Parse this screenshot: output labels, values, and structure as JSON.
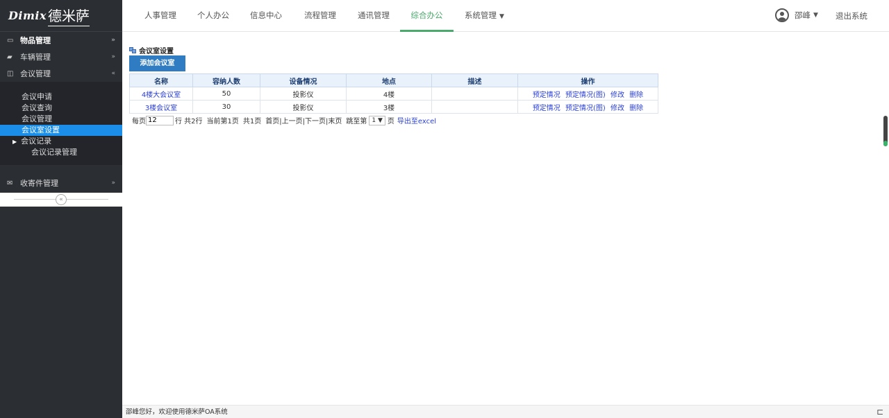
{
  "logo": {
    "latin": "Dimix",
    "cn": "德米萨"
  },
  "topnav": {
    "items": [
      {
        "label": "人事管理",
        "active": false
      },
      {
        "label": "个人办公",
        "active": false
      },
      {
        "label": "信息中心",
        "active": false
      },
      {
        "label": "流程管理",
        "active": false
      },
      {
        "label": "通讯管理",
        "active": false
      },
      {
        "label": "综合办公",
        "active": true
      },
      {
        "label": "系统管理",
        "active": false
      }
    ],
    "user_name": "邵峰",
    "logout": "退出系统"
  },
  "sidebar": {
    "groups": [
      {
        "label": "物品管理",
        "icon": "tray-icon",
        "chevron": "»"
      },
      {
        "label": "车辆管理",
        "icon": "truck-icon",
        "chevron": "»"
      },
      {
        "label": "会议管理",
        "icon": "columns-icon",
        "chevron": "«"
      }
    ],
    "sub_items": [
      {
        "label": "会议申请"
      },
      {
        "label": "会议查询"
      },
      {
        "label": "会议管理"
      },
      {
        "label": "会议室设置"
      },
      {
        "label": "会议记录"
      },
      {
        "label": "会议记录管理"
      }
    ],
    "mail_group": {
      "label": "收寄件管理",
      "icon": "envelope-icon",
      "chevron": "»"
    },
    "collapse_symbol": "«"
  },
  "main": {
    "title": "会议室设置",
    "add_button": "添加会议室",
    "columns": [
      "名称",
      "容纳人数",
      "设备情况",
      "地点",
      "描述",
      "操作"
    ],
    "rows": [
      {
        "name": "4楼大会议室",
        "capacity": "50",
        "equipment": "投影仪",
        "location": "4楼",
        "desc": ""
      },
      {
        "name": "3楼会议室",
        "capacity": "30",
        "equipment": "投影仪",
        "location": "3楼",
        "desc": ""
      }
    ],
    "row_actions": [
      "预定情况",
      "预定情况(图)",
      "修改",
      "删除"
    ],
    "pager": {
      "per_page_label": "每页",
      "per_page_value": "12",
      "rows_info": "行 共2行",
      "current": "当前第1页",
      "total_pages": "共1页",
      "nav": "首页|上一页|下一页|末页",
      "jump_label": "跳至第",
      "jump_value": "1 ▼",
      "page_suffix": "页",
      "export": "导出至excel"
    }
  },
  "footer": {
    "greeting": "邵峰您好，欢迎使用德米萨OA系统"
  }
}
